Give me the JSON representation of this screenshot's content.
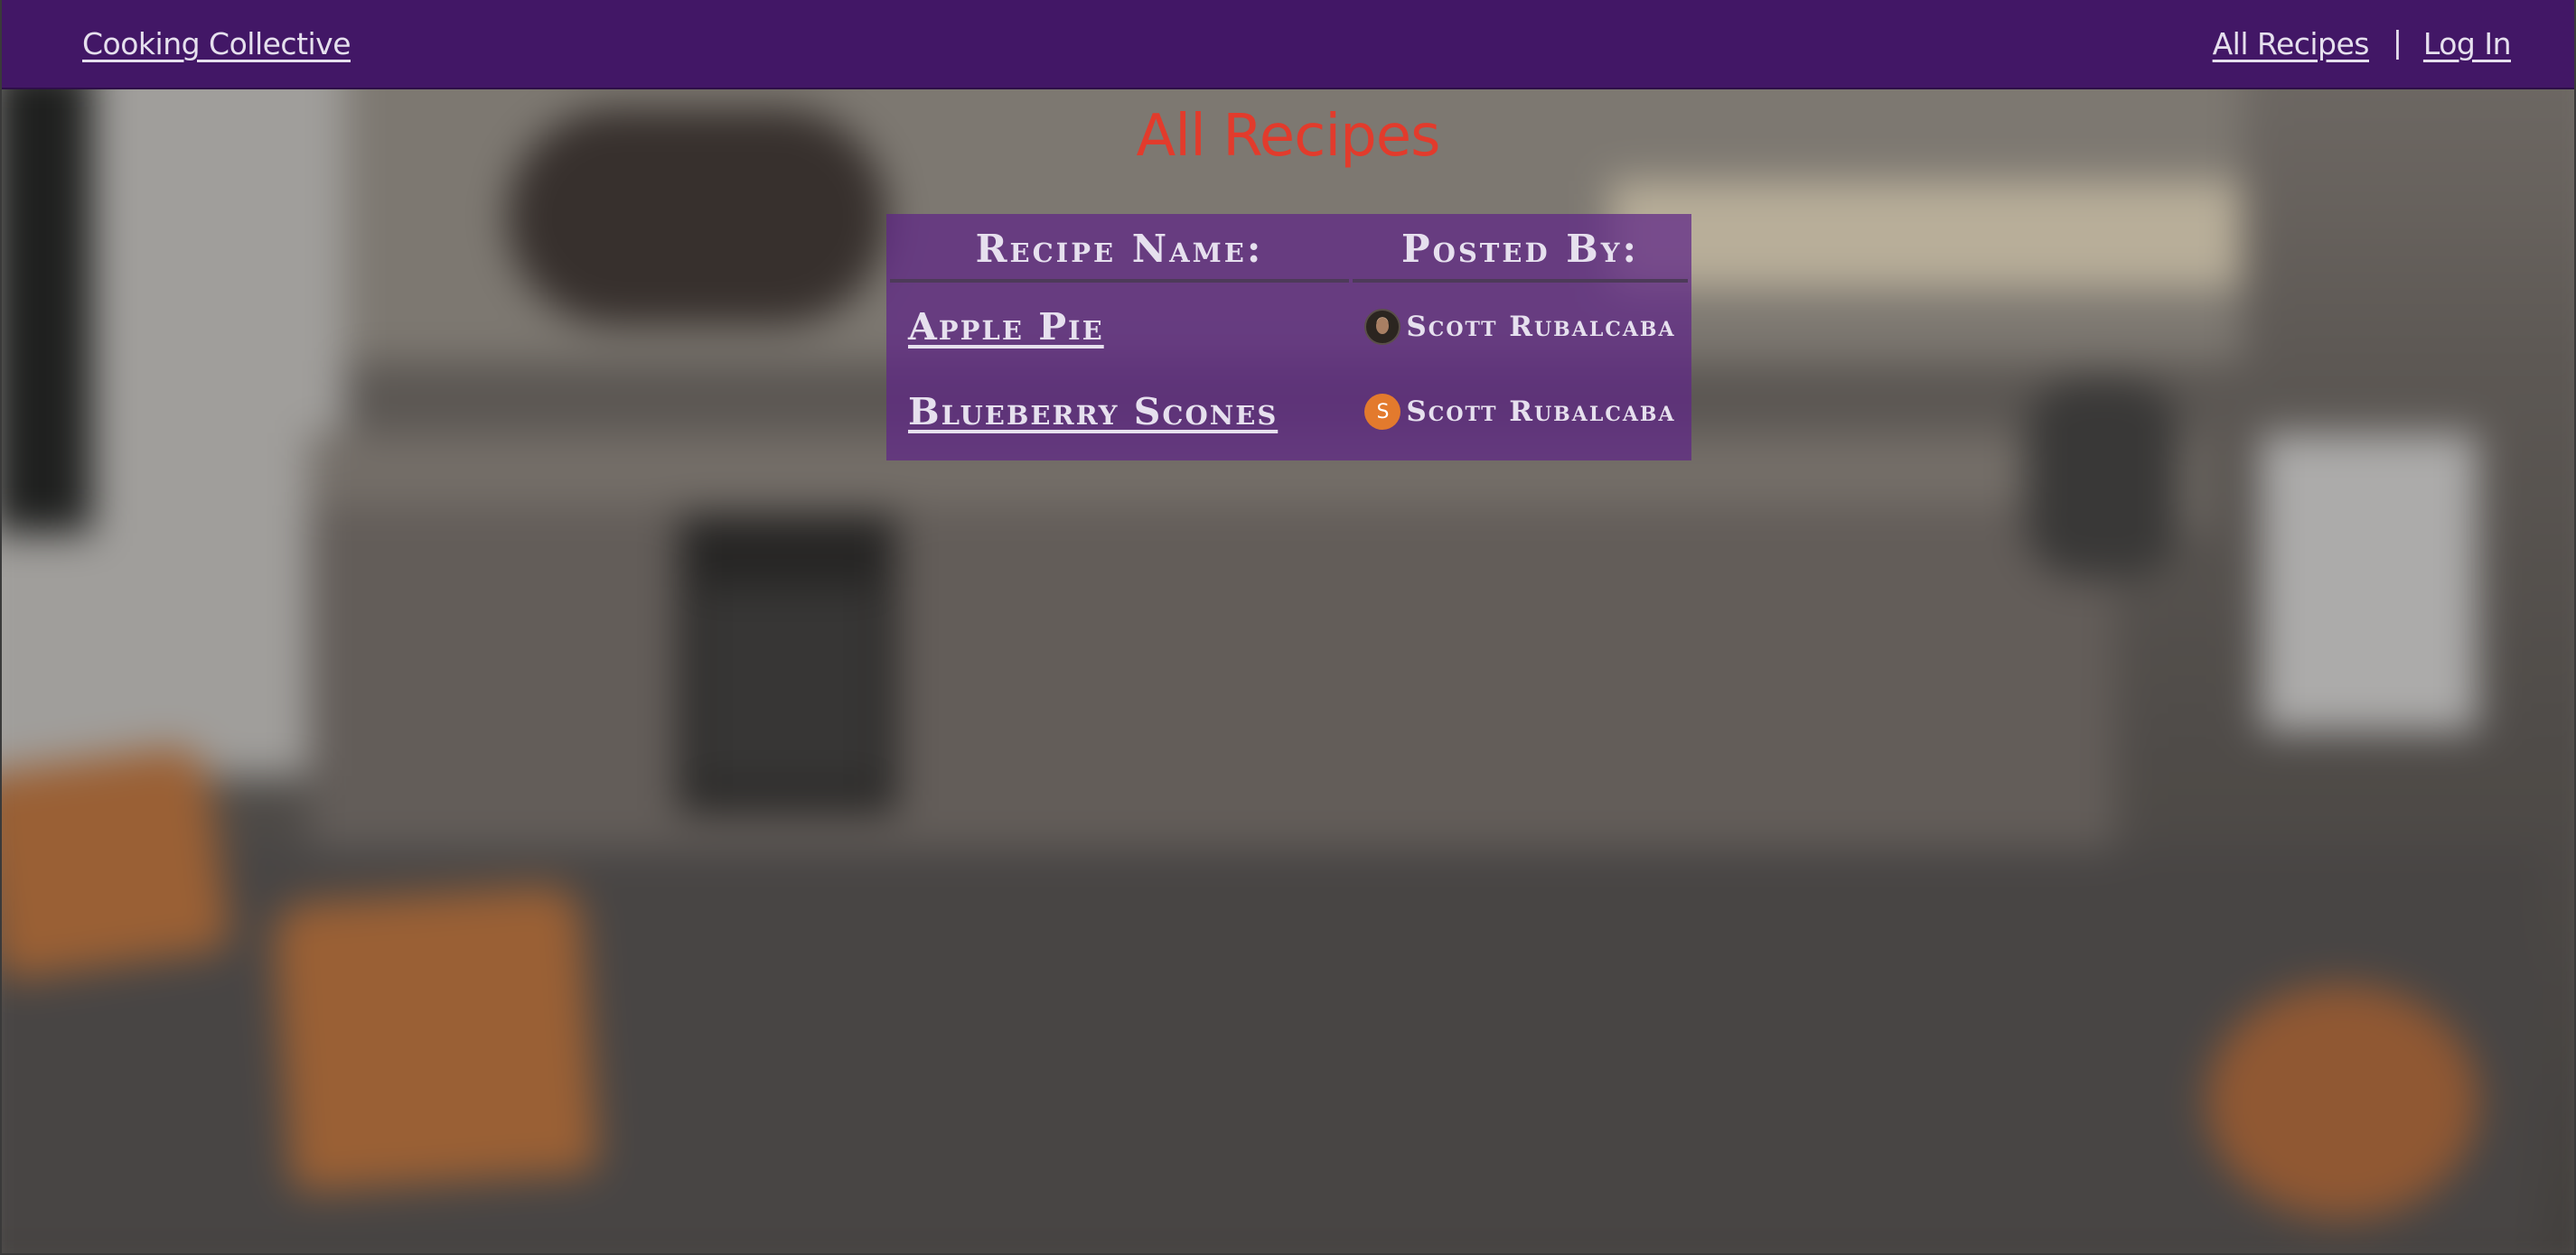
{
  "navbar": {
    "brand": "Cooking Collective",
    "all_recipes": "All Recipes",
    "separator": "|",
    "login": "Log In"
  },
  "page": {
    "title": "All Recipes"
  },
  "table": {
    "headers": {
      "recipe_name": "Recipe Name:",
      "posted_by": "Posted By:"
    },
    "rows": [
      {
        "recipe": "Apple Pie",
        "poster": "Scott Rubalcaba",
        "avatar": "user-photo-icon"
      },
      {
        "recipe": "Blueberry Scones",
        "poster": "Scott Rubalcaba",
        "avatar": "initial-avatar-icon",
        "avatar_initial": "S"
      }
    ]
  },
  "colors": {
    "navbar_bg": "#421766",
    "title": "#e23b2c",
    "table_bg": "#5e2686",
    "avatar_initial_bg": "#e37a2d",
    "text": "#e6e0ee"
  }
}
